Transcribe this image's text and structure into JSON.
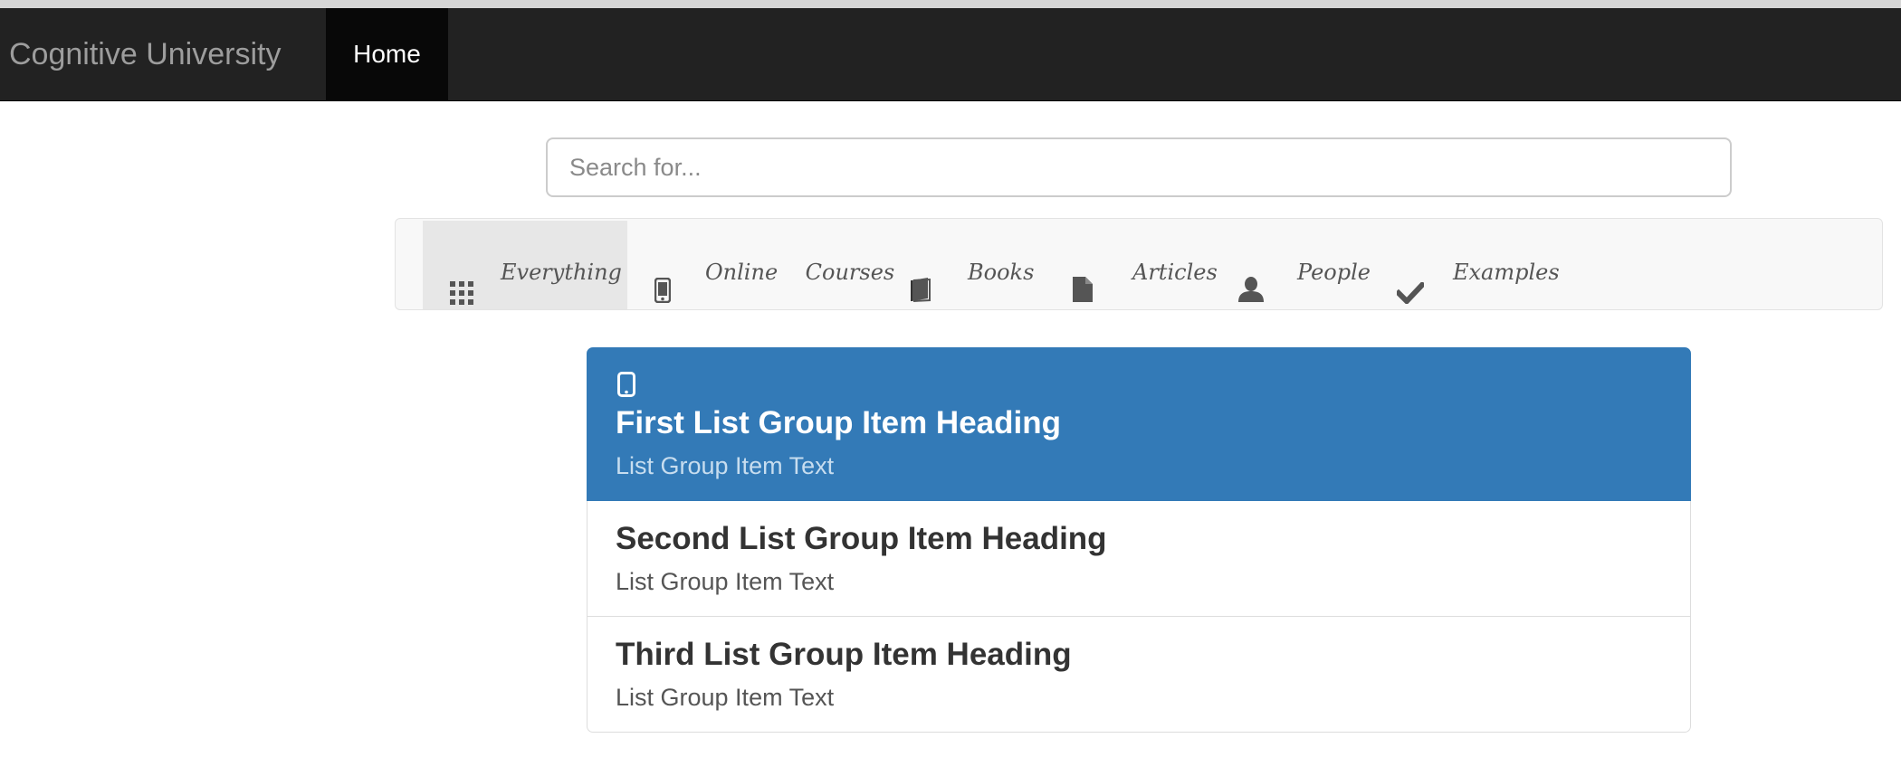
{
  "navbar": {
    "brand": "Cognitive University",
    "home_label": "Home"
  },
  "search": {
    "placeholder": "Search for..."
  },
  "filters": [
    {
      "label": "Everything",
      "icon": "grid-icon",
      "active": true
    },
    {
      "label": "Online    Courses",
      "icon": "phone-icon",
      "active": false
    },
    {
      "label": "Books",
      "icon": "book-icon",
      "active": false
    },
    {
      "label": "Articles",
      "icon": "file-icon",
      "active": false
    },
    {
      "label": "People",
      "icon": "user-icon",
      "active": false
    },
    {
      "label": "Examples",
      "icon": "check-icon",
      "active": false
    }
  ],
  "list_items": [
    {
      "heading": "First List Group Item Heading",
      "text": "List Group Item Text",
      "icon": "phone-icon",
      "active": true
    },
    {
      "heading": "Second List Group Item Heading",
      "text": "List Group Item Text",
      "active": false
    },
    {
      "heading": "Third List Group Item Heading",
      "text": "List Group Item Text",
      "active": false
    }
  ],
  "colors": {
    "navbar_bg": "#222222",
    "active_item": "#337ab7"
  }
}
